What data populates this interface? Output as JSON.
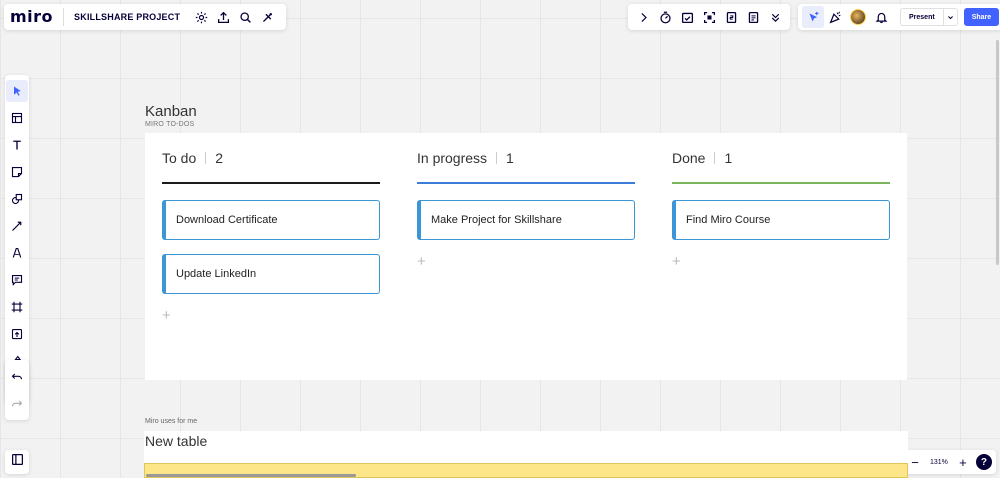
{
  "app": {
    "logo": "miro",
    "board_name": "SKILLSHARE PROJECT"
  },
  "top_right": {
    "present_label": "Present",
    "share_label": "Share"
  },
  "zoom": {
    "value": "131%",
    "minus": "−",
    "plus": "+",
    "help": "?"
  },
  "kanban": {
    "title": "Kanban",
    "subtitle": "MIRO TO-DOS",
    "columns": [
      {
        "name": "To do",
        "count": "2",
        "color": "#1a1a1a",
        "cards": [
          "Download Certificate",
          "Update LinkedIn"
        ]
      },
      {
        "name": "In progress",
        "count": "1",
        "color": "#3b7dd8",
        "cards": [
          "Make Project for Skillshare"
        ]
      },
      {
        "name": "Done",
        "count": "1",
        "color": "#7ab55c",
        "cards": [
          "Find Miro Course"
        ]
      }
    ],
    "add_symbol": "+"
  },
  "table": {
    "subtitle": "Miro uses for me",
    "title": "New table"
  },
  "icons": {
    "top_left": [
      "settings-icon",
      "upload-icon",
      "search-icon",
      "apps-icon"
    ],
    "top_mid": [
      "chevron-right-icon",
      "timer-icon",
      "vote-icon",
      "frame-focus-icon",
      "card-count-icon",
      "notes-icon",
      "chevron-double-down-icon"
    ],
    "top_right": [
      "cursor-select-icon",
      "celebrate-icon",
      "avatar",
      "bell-icon"
    ],
    "left_toolbar": [
      "select-icon",
      "templates-icon",
      "text-icon",
      "sticky-note-icon",
      "shapes-icon",
      "connector-line-icon",
      "pen-icon",
      "comment-icon",
      "frame-icon",
      "upload-icon",
      "more-apps-icon",
      "add-icon"
    ],
    "undo": [
      "undo-icon",
      "redo-icon"
    ],
    "bottom_left": "sidebar-toggle-icon"
  }
}
